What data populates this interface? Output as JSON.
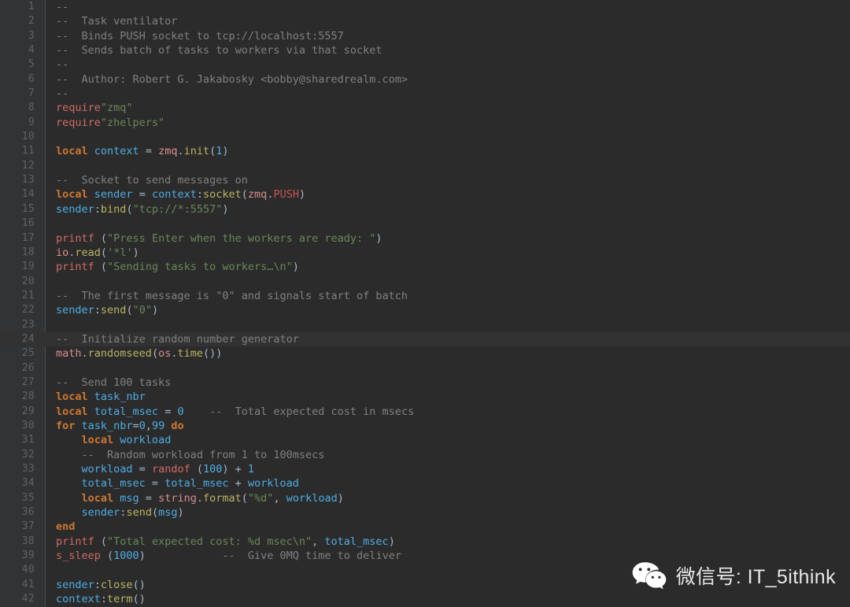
{
  "editor": {
    "language": "lua",
    "background_color": "#2b2b2b",
    "gutter_color": "#313335",
    "current_line": 24,
    "first_line": 1,
    "last_line": 42,
    "colors": {
      "comment": "#808080",
      "keyword": "#cc7832",
      "string": "#6a8759",
      "number": "#4eade5",
      "identifier": "#4eade5",
      "function": "#cf6a66",
      "method": "#b9b562",
      "library": "#d98d8d",
      "constant": "#c75450",
      "default_text": "#a9b7c6",
      "line_number": "#606366"
    }
  },
  "lines": [
    {
      "n": "1",
      "tokens": [
        {
          "t": "--",
          "c": "cmt"
        }
      ]
    },
    {
      "n": "2",
      "tokens": [
        {
          "t": "--  Task ventilator",
          "c": "cmt"
        }
      ]
    },
    {
      "n": "3",
      "tokens": [
        {
          "t": "--  Binds PUSH socket to tcp://localhost:5557",
          "c": "cmt"
        }
      ]
    },
    {
      "n": "4",
      "tokens": [
        {
          "t": "--  Sends batch of tasks to workers via that socket",
          "c": "cmt"
        }
      ]
    },
    {
      "n": "5",
      "tokens": [
        {
          "t": "--",
          "c": "cmt"
        }
      ]
    },
    {
      "n": "6",
      "tokens": [
        {
          "t": "--  Author: Robert G. Jakabosky <bobby@sharedrealm.com>",
          "c": "cmt"
        }
      ]
    },
    {
      "n": "7",
      "tokens": [
        {
          "t": "--",
          "c": "cmt"
        }
      ]
    },
    {
      "n": "8",
      "tokens": [
        {
          "t": "require",
          "c": "fn"
        },
        {
          "t": "\"zmq\"",
          "c": "str"
        }
      ]
    },
    {
      "n": "9",
      "tokens": [
        {
          "t": "require",
          "c": "fn"
        },
        {
          "t": "\"zhelpers\"",
          "c": "str"
        }
      ]
    },
    {
      "n": "10",
      "tokens": []
    },
    {
      "n": "11",
      "tokens": [
        {
          "t": "local",
          "c": "kw"
        },
        {
          "t": " ",
          "c": "punc"
        },
        {
          "t": "context",
          "c": "ident"
        },
        {
          "t": " = ",
          "c": "op"
        },
        {
          "t": "zmq",
          "c": "lib"
        },
        {
          "t": ".",
          "c": "punc"
        },
        {
          "t": "init",
          "c": "meth"
        },
        {
          "t": "(",
          "c": "punc"
        },
        {
          "t": "1",
          "c": "num"
        },
        {
          "t": ")",
          "c": "punc"
        }
      ]
    },
    {
      "n": "12",
      "tokens": []
    },
    {
      "n": "13",
      "tokens": [
        {
          "t": "--  Socket to send messages on",
          "c": "cmt"
        }
      ]
    },
    {
      "n": "14",
      "tokens": [
        {
          "t": "local",
          "c": "kw"
        },
        {
          "t": " ",
          "c": "punc"
        },
        {
          "t": "sender",
          "c": "ident"
        },
        {
          "t": " = ",
          "c": "op"
        },
        {
          "t": "context",
          "c": "ident"
        },
        {
          "t": ":",
          "c": "punc"
        },
        {
          "t": "socket",
          "c": "meth"
        },
        {
          "t": "(",
          "c": "punc"
        },
        {
          "t": "zmq",
          "c": "lib"
        },
        {
          "t": ".",
          "c": "punc"
        },
        {
          "t": "PUSH",
          "c": "cnst"
        },
        {
          "t": ")",
          "c": "punc"
        }
      ]
    },
    {
      "n": "15",
      "tokens": [
        {
          "t": "sender",
          "c": "ident"
        },
        {
          "t": ":",
          "c": "punc"
        },
        {
          "t": "bind",
          "c": "meth"
        },
        {
          "t": "(",
          "c": "punc"
        },
        {
          "t": "\"tcp://*:5557\"",
          "c": "str"
        },
        {
          "t": ")",
          "c": "punc"
        }
      ]
    },
    {
      "n": "16",
      "tokens": []
    },
    {
      "n": "17",
      "tokens": [
        {
          "t": "printf",
          "c": "fn"
        },
        {
          "t": " (",
          "c": "punc"
        },
        {
          "t": "\"Press Enter when the workers are ready: \"",
          "c": "str"
        },
        {
          "t": ")",
          "c": "punc"
        }
      ]
    },
    {
      "n": "18",
      "tokens": [
        {
          "t": "io",
          "c": "lib"
        },
        {
          "t": ".",
          "c": "punc"
        },
        {
          "t": "read",
          "c": "meth"
        },
        {
          "t": "(",
          "c": "punc"
        },
        {
          "t": "'*l'",
          "c": "str"
        },
        {
          "t": ")",
          "c": "punc"
        }
      ]
    },
    {
      "n": "19",
      "tokens": [
        {
          "t": "printf",
          "c": "fn"
        },
        {
          "t": " (",
          "c": "punc"
        },
        {
          "t": "\"Sending tasks to workers…\\n\"",
          "c": "str"
        },
        {
          "t": ")",
          "c": "punc"
        }
      ]
    },
    {
      "n": "20",
      "tokens": []
    },
    {
      "n": "21",
      "tokens": [
        {
          "t": "--  The first message is \"0\" and signals start of batch",
          "c": "cmt"
        }
      ]
    },
    {
      "n": "22",
      "tokens": [
        {
          "t": "sender",
          "c": "ident"
        },
        {
          "t": ":",
          "c": "punc"
        },
        {
          "t": "send",
          "c": "meth"
        },
        {
          "t": "(",
          "c": "punc"
        },
        {
          "t": "\"0\"",
          "c": "str"
        },
        {
          "t": ")",
          "c": "punc"
        }
      ]
    },
    {
      "n": "23",
      "tokens": []
    },
    {
      "n": "24",
      "tokens": [
        {
          "t": "--  Initialize random number generator",
          "c": "cmt"
        }
      ]
    },
    {
      "n": "25",
      "tokens": [
        {
          "t": "math",
          "c": "lib"
        },
        {
          "t": ".",
          "c": "punc"
        },
        {
          "t": "randomseed",
          "c": "meth"
        },
        {
          "t": "(",
          "c": "punc"
        },
        {
          "t": "os",
          "c": "lib"
        },
        {
          "t": ".",
          "c": "punc"
        },
        {
          "t": "time",
          "c": "meth"
        },
        {
          "t": "())",
          "c": "punc"
        }
      ]
    },
    {
      "n": "26",
      "tokens": []
    },
    {
      "n": "27",
      "tokens": [
        {
          "t": "--  Send 100 tasks",
          "c": "cmt"
        }
      ]
    },
    {
      "n": "28",
      "tokens": [
        {
          "t": "local",
          "c": "kw"
        },
        {
          "t": " ",
          "c": "punc"
        },
        {
          "t": "task_nbr",
          "c": "ident"
        }
      ]
    },
    {
      "n": "29",
      "tokens": [
        {
          "t": "local",
          "c": "kw"
        },
        {
          "t": " ",
          "c": "punc"
        },
        {
          "t": "total_msec",
          "c": "ident"
        },
        {
          "t": " = ",
          "c": "op"
        },
        {
          "t": "0",
          "c": "num"
        },
        {
          "t": "    ",
          "c": "punc"
        },
        {
          "t": "--  Total expected cost in msecs",
          "c": "cmt"
        }
      ]
    },
    {
      "n": "30",
      "tokens": [
        {
          "t": "for",
          "c": "kw"
        },
        {
          "t": " ",
          "c": "punc"
        },
        {
          "t": "task_nbr",
          "c": "ident"
        },
        {
          "t": "=",
          "c": "op"
        },
        {
          "t": "0",
          "c": "num"
        },
        {
          "t": ",",
          "c": "punc"
        },
        {
          "t": "99",
          "c": "num"
        },
        {
          "t": " ",
          "c": "punc"
        },
        {
          "t": "do",
          "c": "kw"
        }
      ]
    },
    {
      "n": "31",
      "tokens": [
        {
          "t": "    ",
          "c": "punc"
        },
        {
          "t": "local",
          "c": "kw"
        },
        {
          "t": " ",
          "c": "punc"
        },
        {
          "t": "workload",
          "c": "ident"
        }
      ]
    },
    {
      "n": "32",
      "tokens": [
        {
          "t": "    ",
          "c": "punc"
        },
        {
          "t": "--  Random workload from 1 to 100msecs",
          "c": "cmt"
        }
      ]
    },
    {
      "n": "33",
      "tokens": [
        {
          "t": "    ",
          "c": "punc"
        },
        {
          "t": "workload",
          "c": "ident"
        },
        {
          "t": " = ",
          "c": "op"
        },
        {
          "t": "randof",
          "c": "fn"
        },
        {
          "t": " (",
          "c": "punc"
        },
        {
          "t": "100",
          "c": "num"
        },
        {
          "t": ") + ",
          "c": "punc"
        },
        {
          "t": "1",
          "c": "num"
        }
      ]
    },
    {
      "n": "34",
      "tokens": [
        {
          "t": "    ",
          "c": "punc"
        },
        {
          "t": "total_msec",
          "c": "ident"
        },
        {
          "t": " = ",
          "c": "op"
        },
        {
          "t": "total_msec",
          "c": "ident"
        },
        {
          "t": " + ",
          "c": "op"
        },
        {
          "t": "workload",
          "c": "ident"
        }
      ]
    },
    {
      "n": "35",
      "tokens": [
        {
          "t": "    ",
          "c": "punc"
        },
        {
          "t": "local",
          "c": "kw"
        },
        {
          "t": " ",
          "c": "punc"
        },
        {
          "t": "msg",
          "c": "ident"
        },
        {
          "t": " = ",
          "c": "op"
        },
        {
          "t": "string",
          "c": "lib"
        },
        {
          "t": ".",
          "c": "punc"
        },
        {
          "t": "format",
          "c": "meth"
        },
        {
          "t": "(",
          "c": "punc"
        },
        {
          "t": "\"%d\"",
          "c": "str"
        },
        {
          "t": ", ",
          "c": "punc"
        },
        {
          "t": "workload",
          "c": "ident"
        },
        {
          "t": ")",
          "c": "punc"
        }
      ]
    },
    {
      "n": "36",
      "tokens": [
        {
          "t": "    ",
          "c": "punc"
        },
        {
          "t": "sender",
          "c": "ident"
        },
        {
          "t": ":",
          "c": "punc"
        },
        {
          "t": "send",
          "c": "meth"
        },
        {
          "t": "(",
          "c": "punc"
        },
        {
          "t": "msg",
          "c": "ident"
        },
        {
          "t": ")",
          "c": "punc"
        }
      ]
    },
    {
      "n": "37",
      "tokens": [
        {
          "t": "end",
          "c": "kw"
        }
      ]
    },
    {
      "n": "38",
      "tokens": [
        {
          "t": "printf",
          "c": "fn"
        },
        {
          "t": " (",
          "c": "punc"
        },
        {
          "t": "\"Total expected cost: %d msec\\n\"",
          "c": "str"
        },
        {
          "t": ", ",
          "c": "punc"
        },
        {
          "t": "total_msec",
          "c": "ident"
        },
        {
          "t": ")",
          "c": "punc"
        }
      ]
    },
    {
      "n": "39",
      "tokens": [
        {
          "t": "s_sleep",
          "c": "fn"
        },
        {
          "t": " (",
          "c": "punc"
        },
        {
          "t": "1000",
          "c": "num"
        },
        {
          "t": ")",
          "c": "punc"
        },
        {
          "t": "            ",
          "c": "punc"
        },
        {
          "t": "--  Give 0MQ time to deliver",
          "c": "cmt"
        }
      ]
    },
    {
      "n": "40",
      "tokens": []
    },
    {
      "n": "41",
      "tokens": [
        {
          "t": "sender",
          "c": "ident"
        },
        {
          "t": ":",
          "c": "punc"
        },
        {
          "t": "close",
          "c": "meth"
        },
        {
          "t": "()",
          "c": "punc"
        }
      ]
    },
    {
      "n": "42",
      "tokens": [
        {
          "t": "context",
          "c": "ident"
        },
        {
          "t": ":",
          "c": "punc"
        },
        {
          "t": "term",
          "c": "meth"
        },
        {
          "t": "()",
          "c": "punc"
        }
      ]
    }
  ],
  "watermark": {
    "icon": "wechat-icon",
    "text": "微信号: IT_5ithink",
    "color": "#e8e8e8"
  }
}
